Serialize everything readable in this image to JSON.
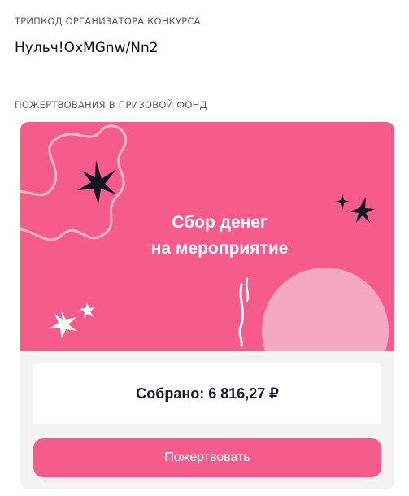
{
  "tripcode": {
    "label": "ТРИПКОД ОРГАНИЗАТОРА КОНКУРСА:",
    "value": "Нульч!OxMGnw/Nn2"
  },
  "donations": {
    "label": "ПОЖЕРТВОВАНИЯ В ПРИЗОВОЙ ФОНД",
    "banner": {
      "title_line1": "Сбор денег",
      "title_line2": "на мероприятие"
    },
    "collected_label": "Собрано:",
    "collected_amount": "6 816,27 ₽",
    "donate_button": "Пожертвовать"
  },
  "colors": {
    "accent": "#f55c8d",
    "card_background": "#f3f3f4",
    "banner_circle": "#f5a8c1",
    "text_dark": "#1a1a2e"
  },
  "icons": [
    "sparkle-icon",
    "star-burst-icon",
    "wavy-blob-decoration",
    "circle-decoration"
  ]
}
